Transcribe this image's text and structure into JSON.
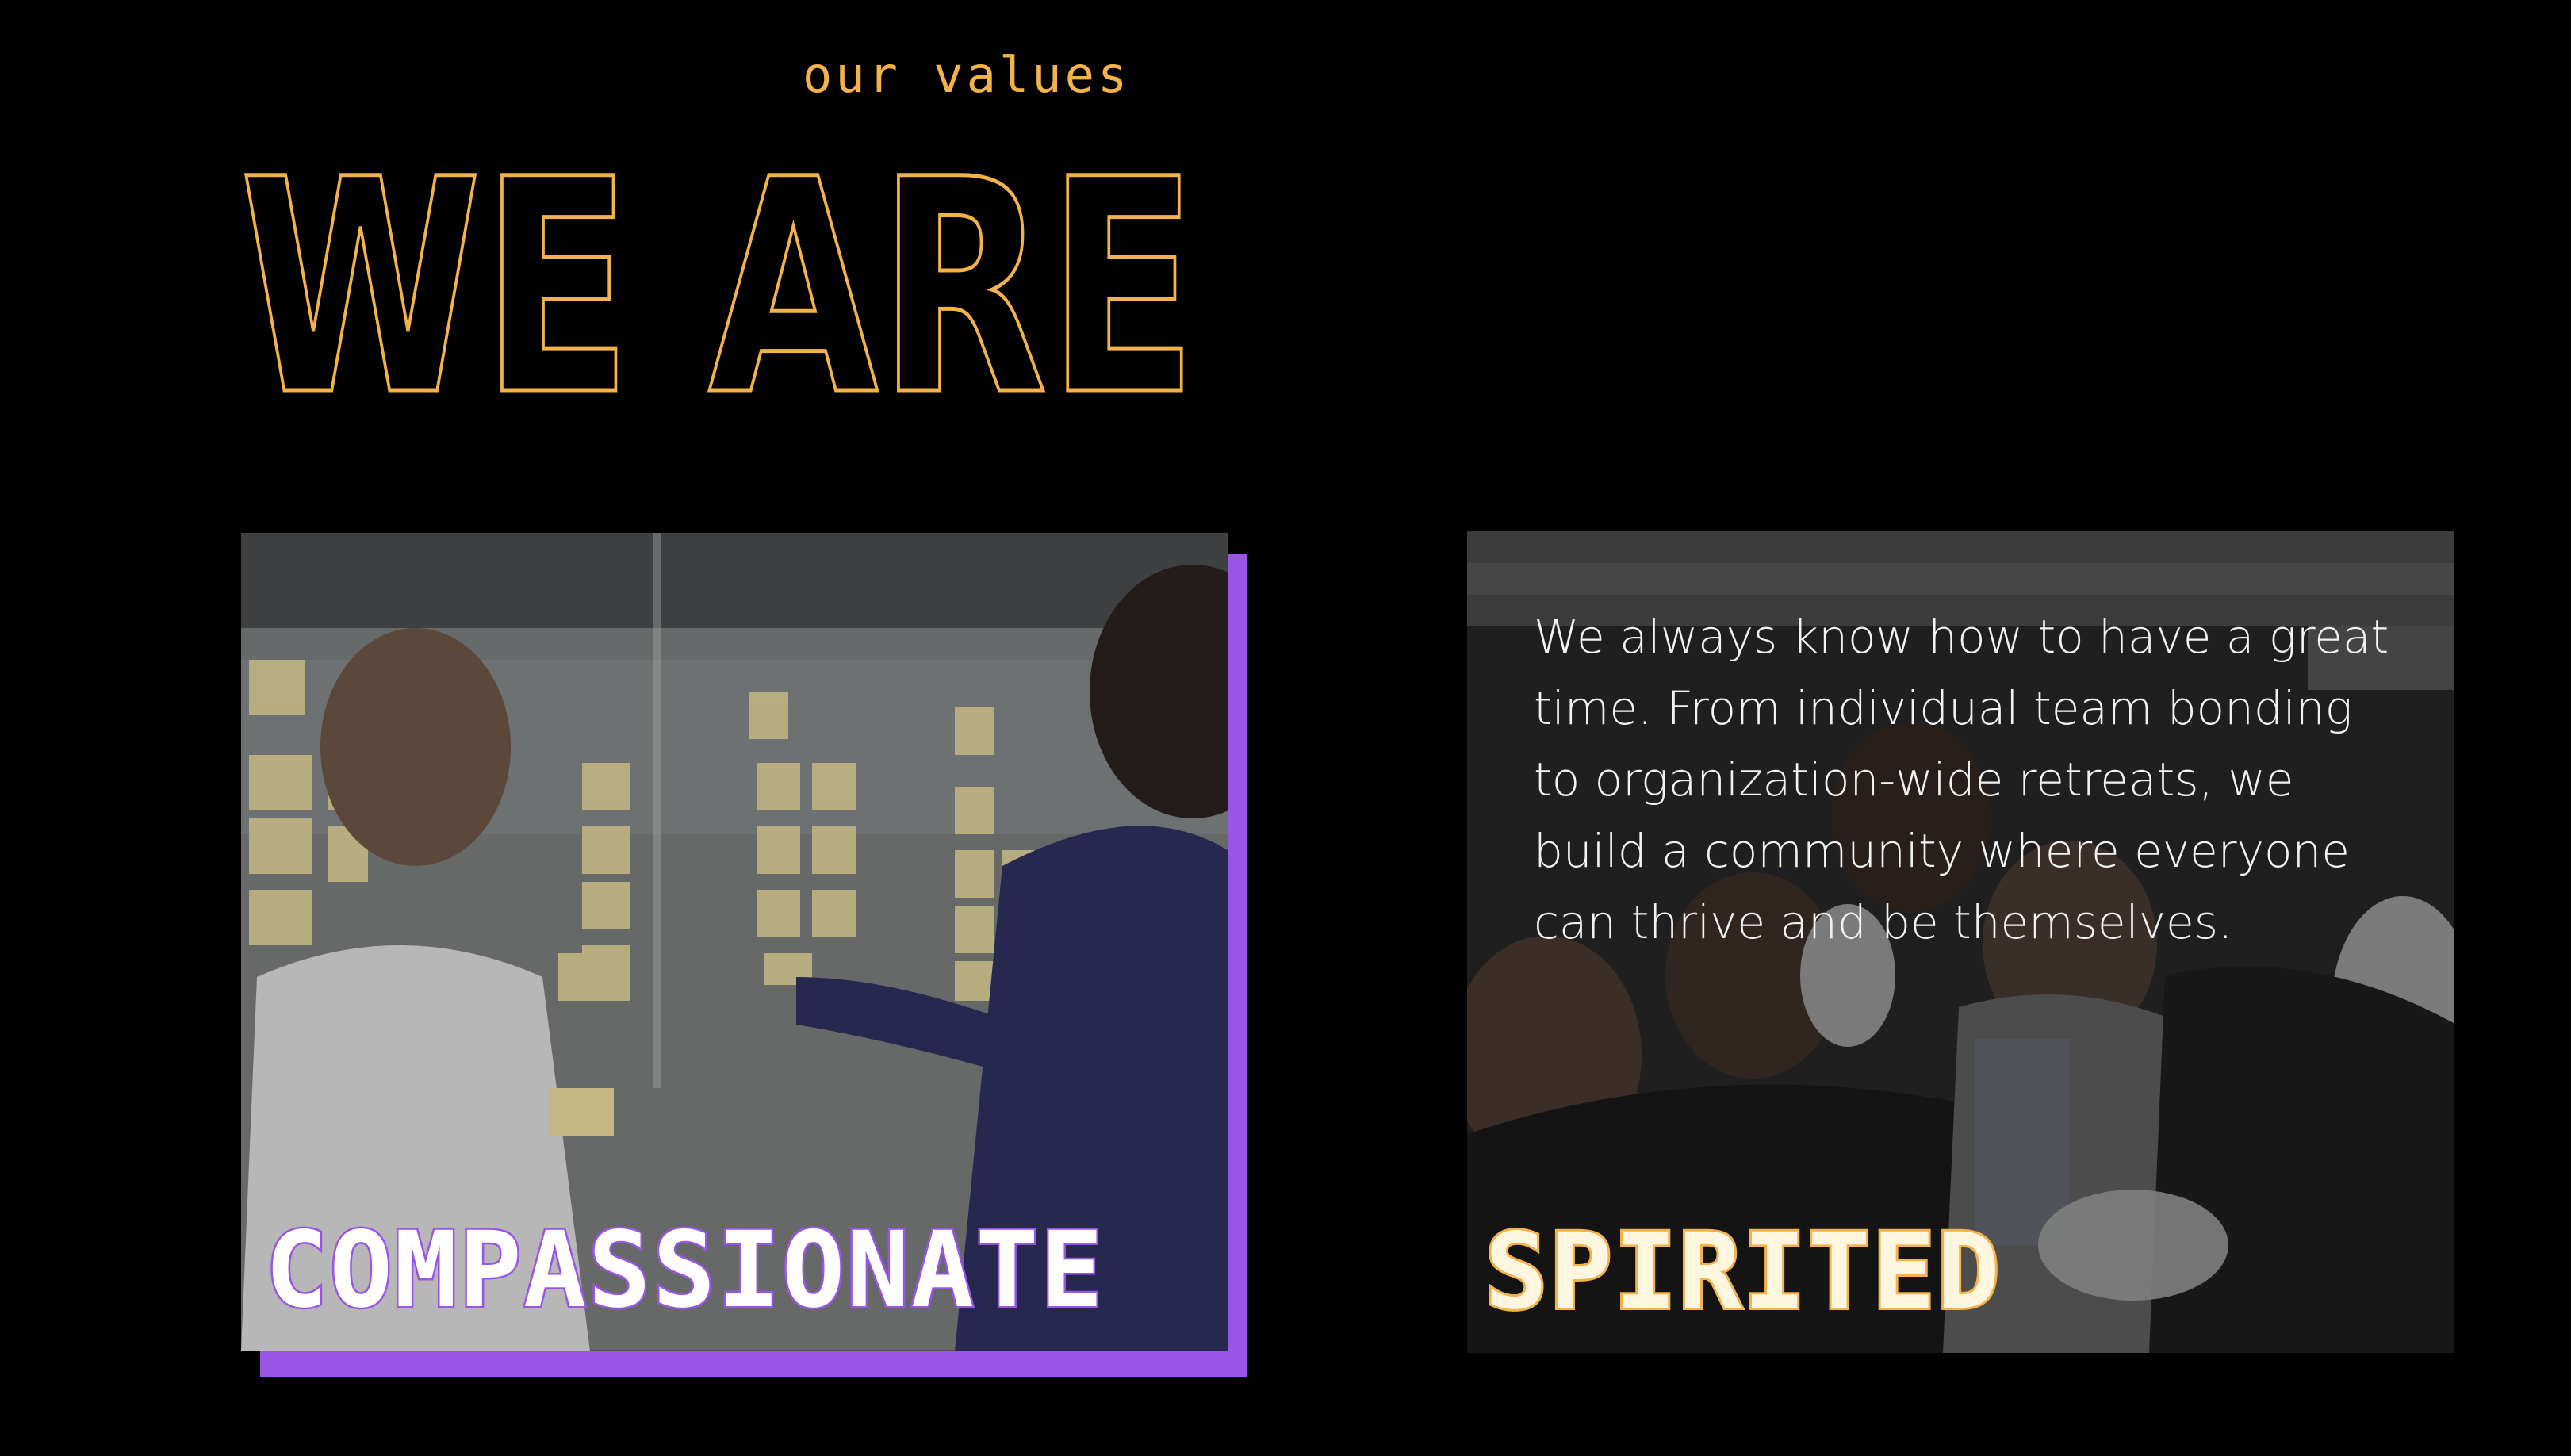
{
  "section": {
    "eyebrow": "our values",
    "headline": "WE ARE"
  },
  "values": [
    {
      "label": "COMPASSIONATE",
      "image": "team-planning-photo"
    },
    {
      "label": "SPIRITED",
      "image": "team-celebration-photo",
      "description": "We always know how to have a great time. From individual team bonding to organization-wide retreats, we build a community where everyone can thrive and be themselves."
    }
  ],
  "colors": {
    "background": "#000000",
    "gold": "#f4b24a",
    "purple": "#9a55e6"
  }
}
